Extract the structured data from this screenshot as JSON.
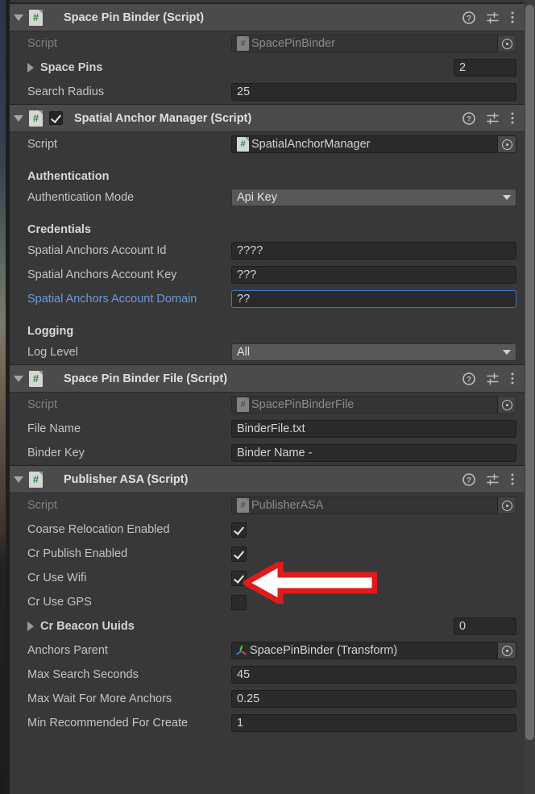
{
  "window": {
    "type": "unity-inspector",
    "accent_focus_color": "#3b79c8",
    "annotation_color": "#e01b1b"
  },
  "components": [
    {
      "title": "Space Pin Binder (Script)",
      "has_enable_checkbox": false,
      "expanded": true,
      "rows": [
        {
          "kind": "objectref",
          "label": "Script",
          "value": "SpacePinBinder",
          "disabled": true
        },
        {
          "kind": "arraysize",
          "label": "Space Pins",
          "value": "2",
          "bold": true,
          "foldout": "collapsed"
        },
        {
          "kind": "text",
          "label": "Search Radius",
          "value": "25"
        }
      ]
    },
    {
      "title": "Spatial Anchor Manager (Script)",
      "has_enable_checkbox": true,
      "enabled": true,
      "expanded": true,
      "rows": [
        {
          "kind": "objectref",
          "label": "Script",
          "value": "SpatialAnchorManager",
          "disabled": false
        },
        {
          "kind": "spacer"
        },
        {
          "kind": "group",
          "label": "Authentication"
        },
        {
          "kind": "dropdown",
          "label": "Authentication Mode",
          "value": "Api Key"
        },
        {
          "kind": "spacer"
        },
        {
          "kind": "group",
          "label": "Credentials"
        },
        {
          "kind": "text",
          "label": "Spatial Anchors Account Id",
          "value": "????"
        },
        {
          "kind": "text",
          "label": "Spatial Anchors Account Key",
          "value": "???"
        },
        {
          "kind": "text",
          "label": "Spatial Anchors Account Domain",
          "value": "??",
          "focused": true,
          "label_link": true
        },
        {
          "kind": "spacer"
        },
        {
          "kind": "group",
          "label": "Logging"
        },
        {
          "kind": "dropdown",
          "label": "Log Level",
          "value": "All"
        }
      ]
    },
    {
      "title": "Space Pin Binder File (Script)",
      "has_enable_checkbox": false,
      "expanded": true,
      "rows": [
        {
          "kind": "objectref",
          "label": "Script",
          "value": "SpacePinBinderFile",
          "disabled": true
        },
        {
          "kind": "text",
          "label": "File Name",
          "value": "BinderFile.txt"
        },
        {
          "kind": "text",
          "label": "Binder Key",
          "value": "Binder Name -"
        }
      ]
    },
    {
      "title": "Publisher ASA (Script)",
      "has_enable_checkbox": false,
      "expanded": true,
      "rows": [
        {
          "kind": "objectref",
          "label": "Script",
          "value": "PublisherASA",
          "disabled": true
        },
        {
          "kind": "checkbox",
          "label": "Coarse Relocation Enabled",
          "checked": true,
          "annotated": true
        },
        {
          "kind": "checkbox",
          "label": "Cr Publish Enabled",
          "checked": true
        },
        {
          "kind": "checkbox",
          "label": "Cr Use Wifi",
          "checked": true
        },
        {
          "kind": "checkbox",
          "label": "Cr Use GPS",
          "checked": false
        },
        {
          "kind": "arraysize",
          "label": "Cr Beacon Uuids",
          "value": "0",
          "bold": true,
          "foldout": "collapsed"
        },
        {
          "kind": "transformref",
          "label": "Anchors Parent",
          "value": "SpacePinBinder (Transform)"
        },
        {
          "kind": "text",
          "label": "Max Search Seconds",
          "value": "45"
        },
        {
          "kind": "text",
          "label": "Max Wait For More Anchors",
          "value": "0.25"
        },
        {
          "kind": "text",
          "label": "Min Recommended For Create",
          "value": "1"
        }
      ]
    }
  ],
  "header_icons": {
    "help": "help-icon",
    "preset": "preset-icon",
    "menu": "more-menu-icon"
  }
}
